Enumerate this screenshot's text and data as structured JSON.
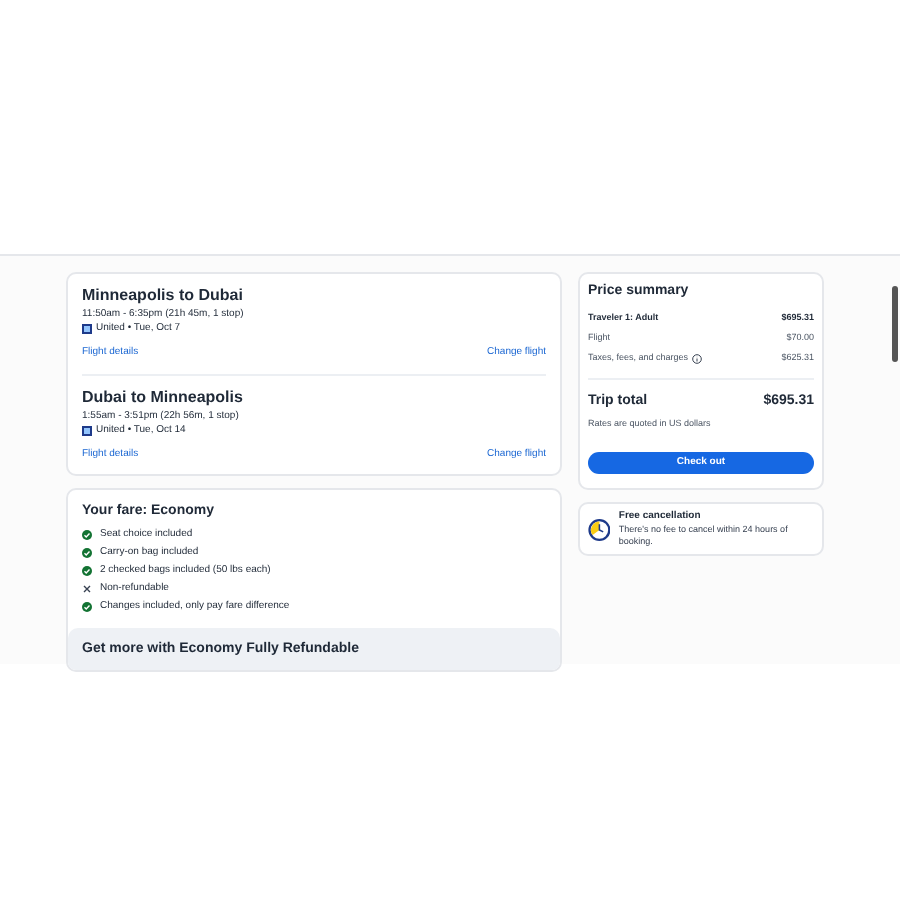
{
  "flights": [
    {
      "title": "Minneapolis to Dubai",
      "times": "11:50am - 6:35pm (21h 45m, 1 stop)",
      "airline": "United • Tue, Oct 7",
      "details_link": "Flight details",
      "change_link": "Change flight"
    },
    {
      "title": "Dubai to Minneapolis",
      "times": "1:55am - 3:51pm (22h 56m, 1 stop)",
      "airline": "United • Tue, Oct 14",
      "details_link": "Flight details",
      "change_link": "Change flight"
    }
  ],
  "fare": {
    "title": "Your fare: Economy",
    "features": [
      {
        "text": "Seat choice included",
        "kind": "included"
      },
      {
        "text": "Carry-on bag included",
        "kind": "included"
      },
      {
        "text": "2 checked bags included (50 lbs each)",
        "kind": "included"
      },
      {
        "text": "Non-refundable",
        "kind": "excluded"
      },
      {
        "text": "Changes included, only pay fare difference",
        "kind": "included"
      }
    ]
  },
  "upsell": {
    "title": "Get more with Economy Fully Refundable"
  },
  "price_summary": {
    "title": "Price summary",
    "lines": [
      {
        "label": "Traveler 1: Adult",
        "amount": "$695.31",
        "kind": "header"
      },
      {
        "label": "Flight",
        "amount": "$70.00",
        "kind": "plain"
      },
      {
        "label": "Taxes, fees, and charges",
        "amount": "$625.31",
        "kind": "info"
      }
    ],
    "total_label": "Trip total",
    "total": "$695.31",
    "note": "Rates are quoted in US dollars",
    "button": "Check out"
  },
  "cancellation": {
    "title": "Free cancellation",
    "text": "There's no fee to cancel within 24 hours of booking."
  }
}
